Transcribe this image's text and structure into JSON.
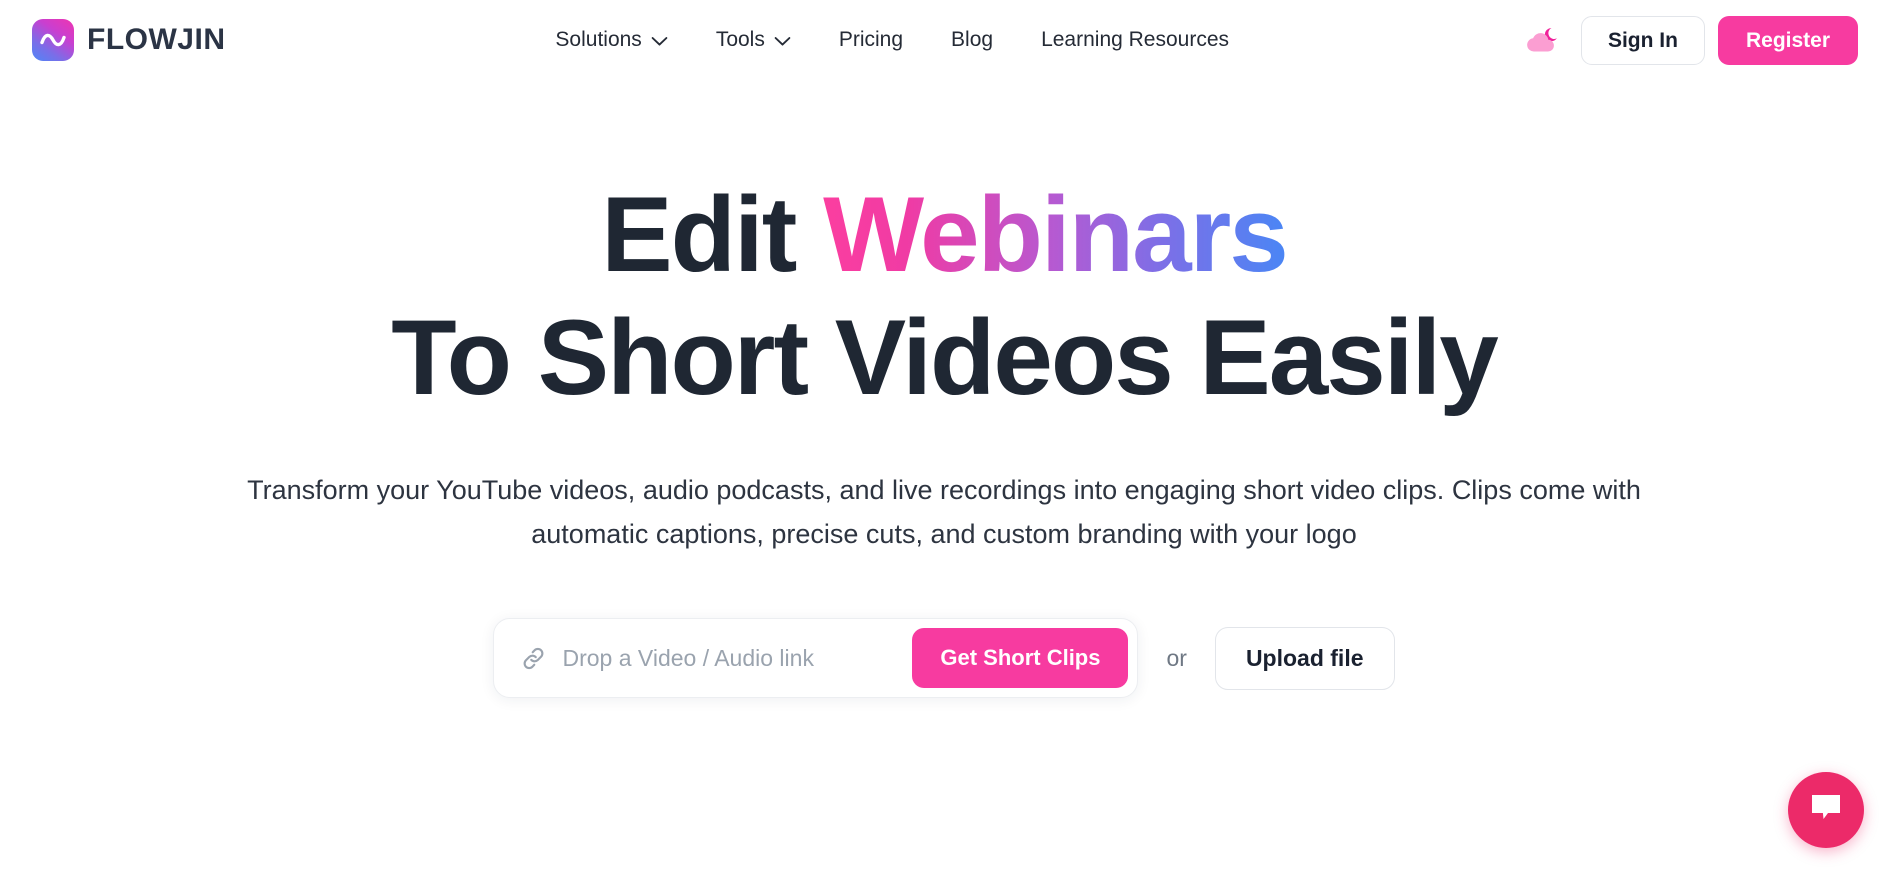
{
  "brand": {
    "name": "FLOWJIN",
    "logo_icon": "wave-tilde-icon",
    "gradient_from": "#ef35b0",
    "gradient_to": "#4f86f7"
  },
  "nav": {
    "items": [
      {
        "label": "Solutions",
        "has_dropdown": true
      },
      {
        "label": "Tools",
        "has_dropdown": true
      },
      {
        "label": "Pricing",
        "has_dropdown": false
      },
      {
        "label": "Blog",
        "has_dropdown": false
      },
      {
        "label": "Learning Resources",
        "has_dropdown": false
      }
    ],
    "theme_toggle_icon": "cloud-moon-icon",
    "sign_in_label": "Sign In",
    "register_label": "Register"
  },
  "hero": {
    "headline_line1_part1": "Edit ",
    "headline_line1_accent": "Webinars",
    "headline_line2": "To Short Videos Easily",
    "subhead": "Transform your YouTube videos, audio podcasts, and live recordings into engaging short video clips. Clips come with automatic captions, precise cuts, and custom branding with your logo"
  },
  "cta": {
    "link_icon": "link-chain-icon",
    "input_value": "",
    "input_placeholder": "Drop a Video / Audio link",
    "primary_label": "Get Short Clips",
    "or_label": "or",
    "upload_label": "Upload file"
  },
  "chat": {
    "icon": "chat-bubble-icon",
    "color": "#ec2a69"
  },
  "colors": {
    "accent_pink": "#f73ba0",
    "text_dark": "#1f2733",
    "chat_pink": "#ec2a69"
  }
}
